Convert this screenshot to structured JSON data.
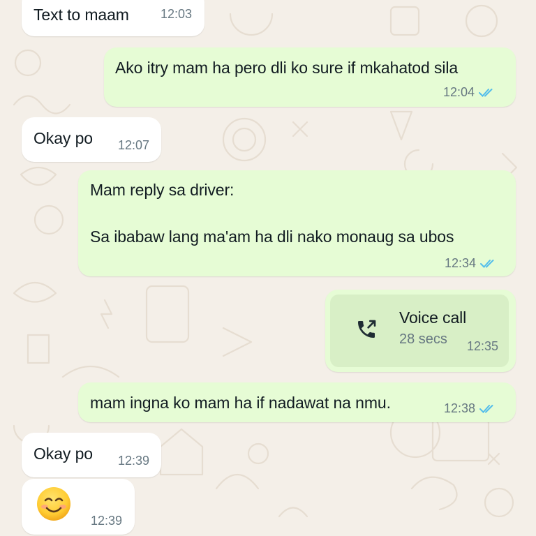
{
  "theme": {
    "background": "#f4efe8",
    "incoming_bubble": "#ffffff",
    "outgoing_bubble": "#e6fcd5",
    "read_tick_color": "#53bdeb"
  },
  "messages": [
    {
      "direction": "incoming",
      "text": "Text to maam",
      "time": "12:03"
    },
    {
      "direction": "outgoing",
      "text": "Ako itry mam ha pero dli ko sure if mkahatod sila",
      "time": "12:04",
      "status": "read"
    },
    {
      "direction": "incoming",
      "text": "Okay po",
      "time": "12:07"
    },
    {
      "direction": "outgoing",
      "text_line1": "Mam reply sa driver:",
      "text_line2": "Sa ibabaw lang ma'am ha dli nako monaug sa ubos",
      "time": "12:34",
      "status": "read"
    },
    {
      "direction": "outgoing",
      "type": "call",
      "call_title": "Voice call",
      "call_duration": "28 secs",
      "icon": "outgoing-call-icon",
      "time": "12:35"
    },
    {
      "direction": "outgoing",
      "text": "mam ingna ko mam ha if nadawat na nmu.",
      "time": "12:38",
      "status": "read"
    },
    {
      "direction": "incoming",
      "text": "Okay po",
      "time": "12:39"
    },
    {
      "direction": "incoming",
      "emoji": "smiling-face-icon",
      "time": "12:39"
    }
  ]
}
